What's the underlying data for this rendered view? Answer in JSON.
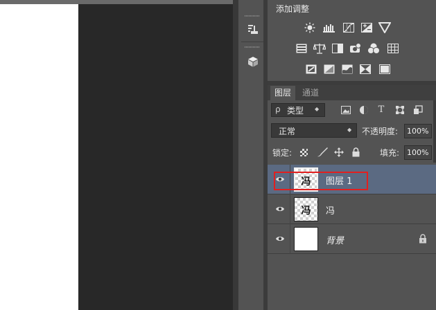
{
  "adjustments": {
    "title": "添加调整",
    "rows": [
      [
        "brightness-contrast-icon",
        "levels-icon",
        "curves-icon",
        "exposure-icon",
        "vibrance-icon"
      ],
      [
        "hue-saturation-icon",
        "color-balance-icon",
        "black-white-icon",
        "photo-filter-icon",
        "channel-mixer-icon",
        "color-lookup-icon"
      ],
      [
        "invert-icon",
        "posterize-icon",
        "threshold-icon",
        "selective-color-icon",
        "gradient-map-icon"
      ]
    ]
  },
  "dock": {
    "buttons": [
      "properties-icon",
      "3d-cube-icon"
    ]
  },
  "layers_panel": {
    "tabs": [
      "图层",
      "通道"
    ],
    "active_tab": "图层",
    "filter": {
      "prefix": "ρ",
      "value": "类型",
      "arrows": "◆"
    },
    "filter_icons": [
      "pixel-filter-icon",
      "adjustment-filter-icon",
      "type-filter-icon",
      "shape-filter-icon",
      "smart-object-filter-icon"
    ],
    "filter_type_glyph": "T",
    "blend_mode": "正常",
    "blend_arrows": "◆",
    "opacity_label": "不透明度:",
    "opacity_value": "100%",
    "lock_label": "锁定:",
    "lock_icons": [
      "lock-transparent-icon",
      "lock-paint-icon",
      "lock-move-icon",
      "lock-all-icon"
    ],
    "fill_label": "填充:",
    "fill_value": "100%",
    "layers": [
      {
        "name": "图层 1",
        "thumb_text": "冯",
        "visible": true,
        "selected": true,
        "locked": false,
        "italic": false
      },
      {
        "name": "冯",
        "thumb_text": "冯",
        "visible": true,
        "selected": false,
        "locked": false,
        "italic": false
      },
      {
        "name": "背景",
        "thumb_text": "",
        "visible": true,
        "selected": false,
        "locked": true,
        "italic": true
      }
    ]
  },
  "colors": {
    "panel_bg": "#535353",
    "selected_row": "#5b6a82",
    "highlight_box": "#e21f1f",
    "workspace": "#282828"
  }
}
